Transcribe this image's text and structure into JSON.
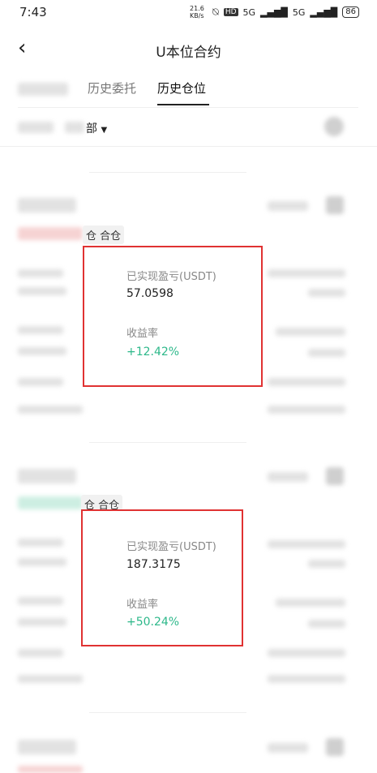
{
  "status_bar": {
    "time": "7:43",
    "net_speed": "21.6 KB/s",
    "hd_label": "HD",
    "signal1": "5G",
    "signal2": "5G",
    "battery": "86"
  },
  "header": {
    "title": "U本位合约",
    "back_icon": "chevron-left-icon"
  },
  "tabs": [
    {
      "label": "历史委托",
      "active": false
    },
    {
      "label": "历史仓位",
      "active": true
    }
  ],
  "filter": {
    "selected": "部",
    "arrow": "▼"
  },
  "positions": [
    {
      "tags": "仓 合仓",
      "realized_pnl_label": "已实现盈亏(USDT)",
      "realized_pnl_value": "57.0598",
      "roi_label": "收益率",
      "roi_value": "+12.42%"
    },
    {
      "tags": "仓 合仓",
      "realized_pnl_label": "已实现盈亏(USDT)",
      "realized_pnl_value": "187.3175",
      "roi_label": "收益率",
      "roi_value": "+50.24%"
    }
  ],
  "colors": {
    "profit_green": "#2db88a",
    "highlight_red": "#e03232"
  }
}
